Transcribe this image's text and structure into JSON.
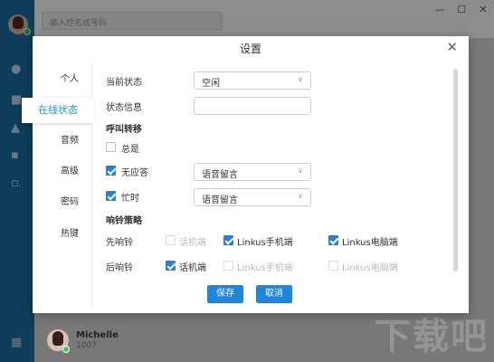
{
  "app": {
    "search_placeholder": "输入姓名或号码",
    "user": {
      "name": "Michelle",
      "extension": "1007"
    },
    "watermark": "下载吧",
    "window_controls": [
      "—",
      "☐",
      "✕"
    ]
  },
  "dialog": {
    "title": "设置",
    "close": "✕",
    "nav": [
      {
        "label": "个人"
      },
      {
        "label": "在线状态",
        "active": true
      },
      {
        "label": "音频"
      },
      {
        "label": "高级"
      },
      {
        "label": "密码"
      },
      {
        "label": "热键"
      }
    ],
    "current_status": {
      "label": "当前状态",
      "value": "空闲"
    },
    "status_info": {
      "label": "状态信息",
      "value": ""
    },
    "call_forward": {
      "section": "呼叫转移",
      "always": {
        "label": "总是",
        "checked": false
      },
      "no_answer": {
        "label": "无应答",
        "checked": true,
        "value": "语音留言"
      },
      "busy": {
        "label": "忙时",
        "checked": true,
        "value": "语音留言"
      }
    },
    "ring_strategy": {
      "section": "响铃策略",
      "first_ring": {
        "label": "先响铃",
        "options": [
          {
            "label": "话机端",
            "checked": false,
            "disabled": true
          },
          {
            "label": "Linkus手机端",
            "checked": true,
            "disabled": false
          },
          {
            "label": "Linkus电脑端",
            "checked": true,
            "disabled": false
          }
        ]
      },
      "later_ring": {
        "label": "后响铃",
        "options": [
          {
            "label": "话机端",
            "checked": true,
            "disabled": false
          },
          {
            "label": "Linkus手机端",
            "checked": false,
            "disabled": true
          },
          {
            "label": "Linkus电脑端",
            "checked": false,
            "disabled": true
          }
        ]
      }
    },
    "buttons": {
      "save": "保存",
      "cancel": "取消"
    }
  }
}
